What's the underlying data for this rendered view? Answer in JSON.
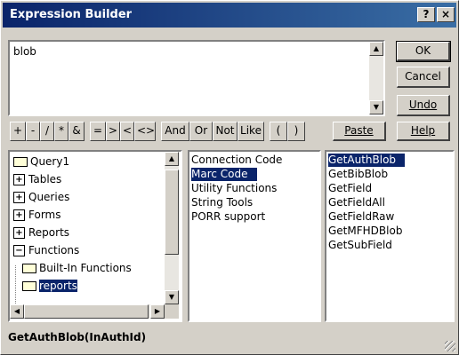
{
  "window": {
    "title": "Expression Builder",
    "help_button": "?",
    "close_button": "×"
  },
  "expression": {
    "value": "blob"
  },
  "buttons": {
    "ok": "OK",
    "cancel": "Cancel",
    "undo": "Undo",
    "paste": "Paste",
    "help": "Help"
  },
  "operators": [
    "+",
    "-",
    "/",
    "*",
    "&",
    "=",
    ">",
    "<",
    "<>",
    "And",
    "Or",
    "Not",
    "Like",
    "(",
    ")"
  ],
  "tree": {
    "items": [
      {
        "label": "Query1",
        "icon": "folder-icon"
      },
      {
        "label": "Tables",
        "icon": "expand-plus-icon"
      },
      {
        "label": "Queries",
        "icon": "expand-plus-icon"
      },
      {
        "label": "Forms",
        "icon": "expand-plus-icon"
      },
      {
        "label": "Reports",
        "icon": "expand-plus-icon"
      },
      {
        "label": "Functions",
        "icon": "collapse-minus-icon"
      },
      {
        "label": "Built-In Functions",
        "icon": "folder-icon"
      },
      {
        "label": "reports",
        "icon": "open-folder-icon"
      }
    ],
    "selected": "reports"
  },
  "categories": {
    "items": [
      "Connection Code",
      "Marc Code",
      "Utility Functions",
      "String Tools",
      "PORR support"
    ],
    "selected": "Marc Code"
  },
  "elements": {
    "items": [
      "GetAuthBlob",
      "GetBibBlob",
      "GetField",
      "GetFieldAll",
      "GetFieldRaw",
      "GetMFHDBlob",
      "GetSubField"
    ],
    "selected": "GetAuthBlob"
  },
  "status": {
    "syntax": "GetAuthBlob(InAuthId)"
  },
  "colors": {
    "title_start": "#0a246a",
    "title_end": "#3a6ea5",
    "selection": "#0a246a",
    "face": "#d4d0c8"
  }
}
